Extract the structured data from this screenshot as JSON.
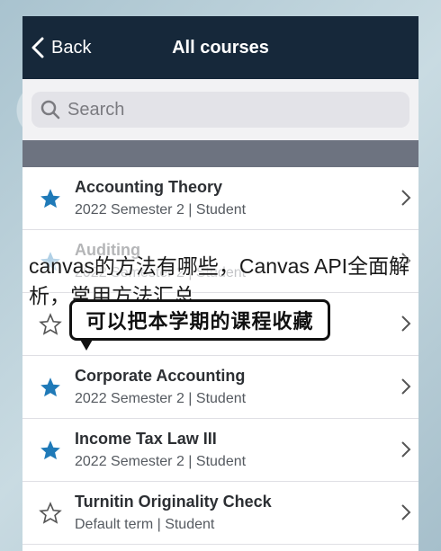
{
  "navbar": {
    "back_label": "Back",
    "title": "All courses"
  },
  "search": {
    "placeholder": "Search"
  },
  "courses": [
    {
      "title": "Accounting Theory",
      "subtitle": "2022 Semester 2  |  Student",
      "starred": true
    },
    {
      "title": "Auditing",
      "subtitle": "2022 Semester 2  |  Student",
      "starred": true
    },
    {
      "title": "",
      "subtitle": "",
      "starred": false
    },
    {
      "title": "Corporate Accounting",
      "subtitle": "2022 Semester 2  |  Student",
      "starred": true
    },
    {
      "title": "Income Tax Law III",
      "subtitle": "2022 Semester 2  |  Student",
      "starred": true
    },
    {
      "title": "Turnitin Originality Check",
      "subtitle": "Default term  |  Student",
      "starred": false
    }
  ],
  "overlay": {
    "caption": "canvas的方法有哪些，Canvas API全面解析，常用方法汇总",
    "bubble_text": "可以把本学期的课程收藏"
  },
  "colors": {
    "navbar": "#16283a",
    "star": "#1f7ab8"
  }
}
